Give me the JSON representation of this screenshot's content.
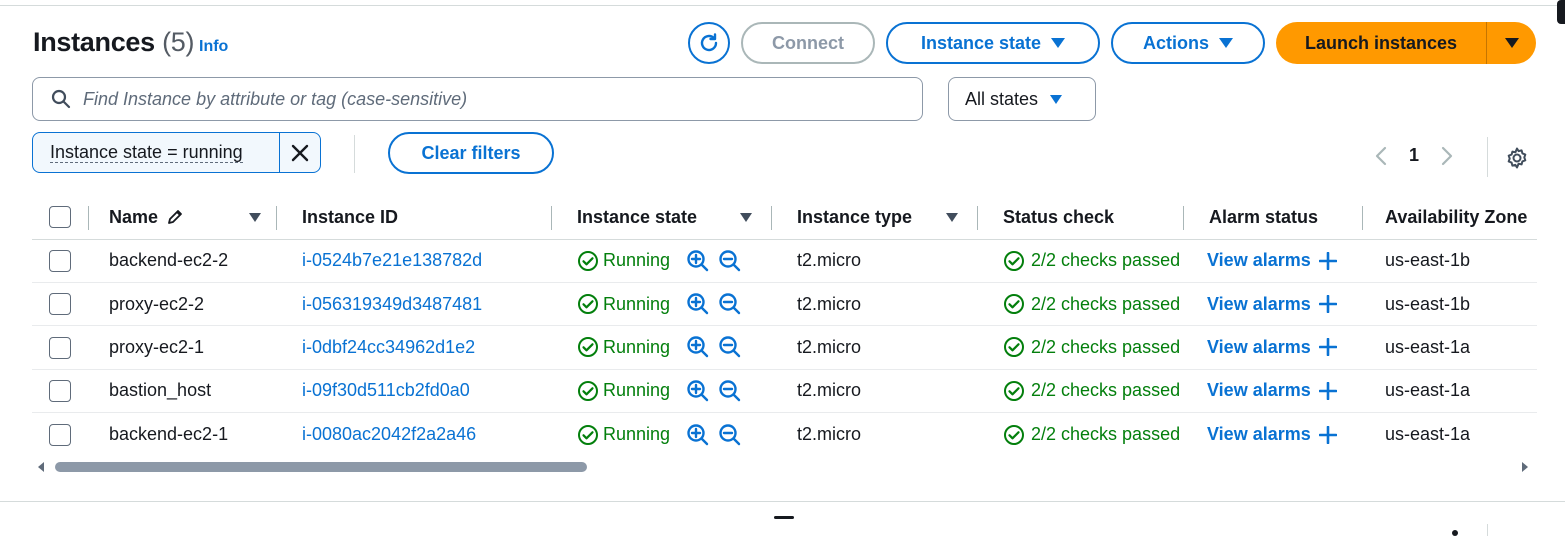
{
  "header": {
    "title": "Instances",
    "count": "(5)",
    "info_link": "Info"
  },
  "toolbar": {
    "connect_label": "Connect",
    "instance_state_label": "Instance state",
    "actions_label": "Actions",
    "launch_label": "Launch instances"
  },
  "search": {
    "placeholder": "Find Instance by attribute or tag (case-sensitive)",
    "states_select": "All states"
  },
  "filters": {
    "token": "Instance state = running",
    "clear_label": "Clear filters"
  },
  "pagination": {
    "current_page": "1"
  },
  "table": {
    "headers": {
      "name": "Name",
      "instance_id": "Instance ID",
      "instance_state": "Instance state",
      "instance_type": "Instance type",
      "status_check": "Status check",
      "alarm_status": "Alarm status",
      "availability_zone": "Availability Zone"
    },
    "rows": [
      {
        "name": "backend-ec2-2",
        "id": "i-0524b7e21e138782d",
        "state": "Running",
        "type": "t2.micro",
        "status": "2/2 checks passed",
        "alarm": "View alarms",
        "az": "us-east-1b"
      },
      {
        "name": "proxy-ec2-2",
        "id": "i-056319349d3487481",
        "state": "Running",
        "type": "t2.micro",
        "status": "2/2 checks passed",
        "alarm": "View alarms",
        "az": "us-east-1b"
      },
      {
        "name": "proxy-ec2-1",
        "id": "i-0dbf24cc34962d1e2",
        "state": "Running",
        "type": "t2.micro",
        "status": "2/2 checks passed",
        "alarm": "View alarms",
        "az": "us-east-1a"
      },
      {
        "name": "bastion_host",
        "id": "i-09f30d511cb2fd0a0",
        "state": "Running",
        "type": "t2.micro",
        "status": "2/2 checks passed",
        "alarm": "View alarms",
        "az": "us-east-1a"
      },
      {
        "name": "backend-ec2-1",
        "id": "i-0080ac2042f2a2a46",
        "state": "Running",
        "type": "t2.micro",
        "status": "2/2 checks passed",
        "alarm": "View alarms",
        "az": "us-east-1a"
      }
    ]
  },
  "colors": {
    "link": "#0972d3",
    "success": "#037f0c",
    "launch_button": "#ff9900",
    "text": "#16191f"
  }
}
